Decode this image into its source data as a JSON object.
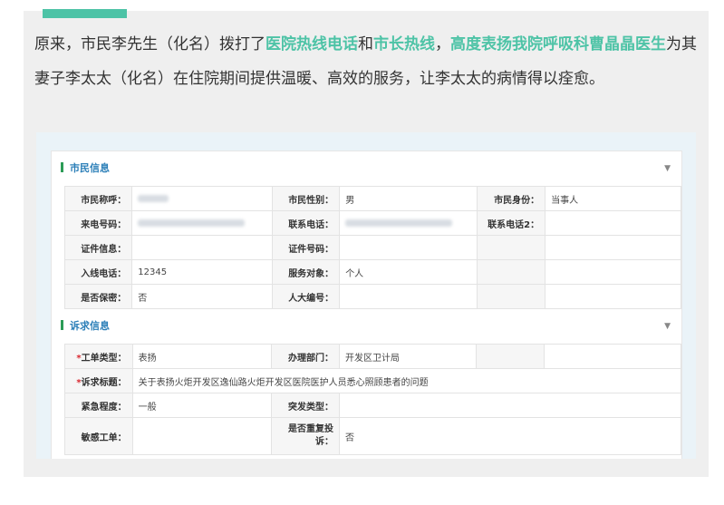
{
  "article": {
    "segments": [
      {
        "text": "原来，市民李先生（化名）拨打了",
        "highlight": false
      },
      {
        "text": "医院热线电话",
        "highlight": true
      },
      {
        "text": "和",
        "highlight": false
      },
      {
        "text": "市长热线",
        "highlight": true
      },
      {
        "text": "，",
        "highlight": false
      },
      {
        "text": "高度表扬我院呼吸科曹晶晶医生",
        "highlight": true
      },
      {
        "text": "为其妻子李太太（化名）在住院期间提供温暖、高效的服务，让李太太的病情得以痊愈。",
        "highlight": false
      }
    ],
    "accent_color": "#4dc3a6"
  },
  "sections": [
    {
      "title": "市民信息",
      "chevron": "▼"
    },
    {
      "title": "诉求信息",
      "chevron": "▼"
    }
  ],
  "citizen": {
    "name_label": "市民称呼：",
    "gender_label": "市民性别：",
    "gender_value": "男",
    "identity_label": "市民身份：",
    "identity_value": "当事人",
    "caller_label": "来电号码：",
    "contact_label": "联系电话：",
    "contact2_label": "联系电话2：",
    "cert_label": "证件信息：",
    "cert_no_label": "证件号码：",
    "line_label": "入线电话：",
    "line_value": "12345",
    "target_label": "服务对象：",
    "target_value": "个人",
    "secret_label": "是否保密：",
    "secret_value": "否",
    "npc_label": "人大编号："
  },
  "request": {
    "type_label": "工单类型：",
    "type_value": "表扬",
    "dept_label": "办理部门：",
    "dept_value": "开发区卫计局",
    "title_label": "诉求标题：",
    "title_value": "关于表扬火炬开发区逸仙路火炬开发区医院医护人员悉心照顾患者的问题",
    "urgency_label": "紧急程度：",
    "urgency_value": "一般",
    "sudden_label": "突发类型：",
    "sensitive_label": "敏感工单：",
    "repeat_label": "是否重复投诉：",
    "repeat_value": "否",
    "required_mark": "*"
  }
}
